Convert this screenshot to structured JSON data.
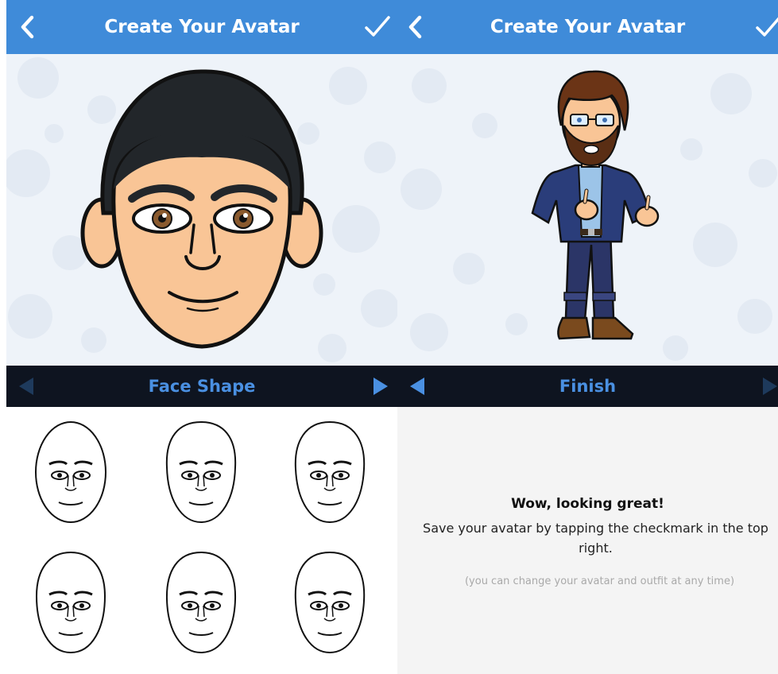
{
  "left_screen": {
    "header": {
      "title": "Create Your Avatar",
      "back_icon": "chevron-left-icon",
      "confirm_icon": "checkmark-icon"
    },
    "category_bar": {
      "label": "Face Shape",
      "prev_icon": "triangle-left-icon",
      "next_icon": "triangle-right-icon"
    },
    "face_options_count": 6
  },
  "right_screen": {
    "header": {
      "title": "Create Your Avatar",
      "back_icon": "chevron-left-icon",
      "confirm_icon": "checkmark-icon"
    },
    "category_bar": {
      "label": "Finish",
      "prev_icon": "triangle-left-icon",
      "next_icon": "triangle-right-icon"
    },
    "finish": {
      "headline": "Wow, looking great!",
      "body": "Save your avatar by tapping the checkmark in the top right.",
      "note": "(you can change your avatar and outfit at any time)"
    }
  },
  "colors": {
    "header_blue": "#3f8bd9",
    "category_bar": "#0e1420",
    "accent_blue": "#4a90e2",
    "skin": "#f9c596",
    "hair_dark": "#22262a"
  }
}
